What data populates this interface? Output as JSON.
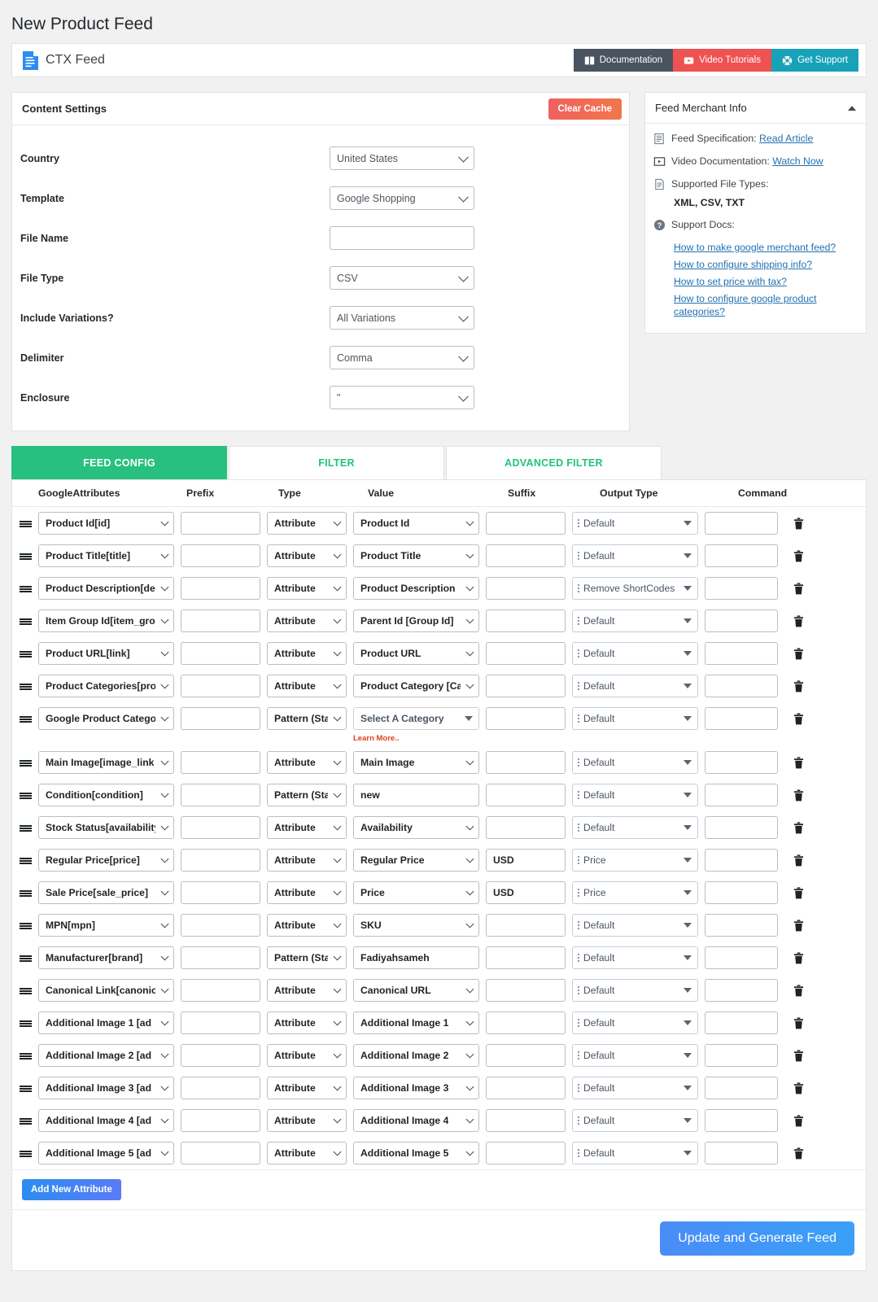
{
  "page": {
    "title": "New Product Feed"
  },
  "app_bar": {
    "brand": "CTX Feed",
    "brand_icon": "document-icon",
    "buttons": [
      {
        "label": "Documentation",
        "icon": "book-icon",
        "color": "#4a5360"
      },
      {
        "label": "Video Tutorials",
        "icon": "video-icon",
        "color": "#ee5253"
      },
      {
        "label": "Get Support",
        "icon": "lifebuoy-icon",
        "color": "#17a2b8"
      }
    ]
  },
  "content_settings": {
    "title": "Content Settings",
    "clear_cache_label": "Clear Cache",
    "fields": [
      {
        "label": "Country",
        "required": true,
        "type": "select",
        "value": "United States"
      },
      {
        "label": "Template",
        "required": true,
        "type": "select",
        "value": "Google Shopping"
      },
      {
        "label": "File Name",
        "required": true,
        "type": "text",
        "value": ""
      },
      {
        "label": "File Type",
        "required": true,
        "type": "select",
        "value": "CSV"
      },
      {
        "label": "Include Variations?",
        "required": true,
        "type": "select",
        "value": "All Variations"
      },
      {
        "label": "Delimiter",
        "required": true,
        "type": "select",
        "value": "Comma"
      },
      {
        "label": "Enclosure",
        "required": true,
        "type": "select",
        "value": "\""
      }
    ]
  },
  "merchant_info": {
    "title": "Feed Merchant Info",
    "spec_label": "Feed Specification:",
    "spec_link": "Read Article",
    "video_label": "Video Documentation:",
    "video_link": "Watch Now",
    "filetypes_label": "Supported File Types:",
    "filetypes_value": "XML, CSV, TXT",
    "support_label": "Support Docs:",
    "support_links": [
      "How to make google merchant feed?",
      "How to configure shipping info?",
      "How to set price with tax?",
      "How to configure google product categories?"
    ]
  },
  "feed": {
    "tabs": [
      {
        "label": "FEED CONFIG",
        "active": true
      },
      {
        "label": "FILTER",
        "active": false
      },
      {
        "label": "ADVANCED FILTER",
        "active": false
      }
    ],
    "columns": [
      "GoogleAttributes",
      "Prefix",
      "Type",
      "Value",
      "Suffix",
      "Output Type",
      "Command"
    ],
    "learn_more_label": "Learn More..",
    "add_attribute_label": "Add New Attribute",
    "generate_label": "Update and Generate Feed",
    "rows": [
      {
        "attribute": "Product Id[id]",
        "prefix": "",
        "type": "Attribute",
        "value": "Product Id",
        "value_kind": "select",
        "suffix": "",
        "output": "Default",
        "command": ""
      },
      {
        "attribute": "Product Title[title]",
        "prefix": "",
        "type": "Attribute",
        "value": "Product Title",
        "value_kind": "select",
        "suffix": "",
        "output": "Default",
        "command": ""
      },
      {
        "attribute": "Product Description[de",
        "prefix": "",
        "type": "Attribute",
        "value": "Product Description",
        "value_kind": "select",
        "suffix": "",
        "output": "Remove ShortCodes",
        "command": ""
      },
      {
        "attribute": "Item Group Id[item_gro",
        "prefix": "",
        "type": "Attribute",
        "value": "Parent Id [Group Id]",
        "value_kind": "select",
        "suffix": "",
        "output": "Default",
        "command": ""
      },
      {
        "attribute": "Product URL[link]",
        "prefix": "",
        "type": "Attribute",
        "value": "Product URL",
        "value_kind": "select",
        "suffix": "",
        "output": "Default",
        "command": ""
      },
      {
        "attribute": "Product Categories[pro",
        "prefix": "",
        "type": "Attribute",
        "value": "Product Category [Ca",
        "value_kind": "select",
        "suffix": "",
        "output": "Default",
        "command": ""
      },
      {
        "attribute": "Google Product Catego",
        "prefix": "",
        "type": "Pattern (Sta",
        "value": "Select A Category",
        "value_kind": "category",
        "suffix": "",
        "output": "Default",
        "command": "",
        "learn_more": true
      },
      {
        "attribute": "Main Image[image_link",
        "prefix": "",
        "type": "Attribute",
        "value": "Main Image",
        "value_kind": "select",
        "suffix": "",
        "output": "Default",
        "command": ""
      },
      {
        "attribute": "Condition[condition]",
        "prefix": "",
        "type": "Pattern (Sta",
        "value": "new",
        "value_kind": "text",
        "suffix": "",
        "output": "Default",
        "command": ""
      },
      {
        "attribute": "Stock Status[availability",
        "prefix": "",
        "type": "Attribute",
        "value": "Availability",
        "value_kind": "select",
        "suffix": "",
        "output": "Default",
        "command": ""
      },
      {
        "attribute": "Regular Price[price]",
        "prefix": "",
        "type": "Attribute",
        "value": "Regular Price",
        "value_kind": "select",
        "suffix": "USD",
        "output": "Price",
        "command": ""
      },
      {
        "attribute": "Sale Price[sale_price]",
        "prefix": "",
        "type": "Attribute",
        "value": "Price",
        "value_kind": "select",
        "suffix": "USD",
        "output": "Price",
        "command": ""
      },
      {
        "attribute": "MPN[mpn]",
        "prefix": "",
        "type": "Attribute",
        "value": "SKU",
        "value_kind": "select",
        "suffix": "",
        "output": "Default",
        "command": ""
      },
      {
        "attribute": "Manufacturer[brand]",
        "prefix": "",
        "type": "Pattern (Sta",
        "value": "Fadiyahsameh",
        "value_kind": "text",
        "suffix": "",
        "output": "Default",
        "command": ""
      },
      {
        "attribute": "Canonical Link[canonic",
        "prefix": "",
        "type": "Attribute",
        "value": "Canonical URL",
        "value_kind": "select",
        "suffix": "",
        "output": "Default",
        "command": ""
      },
      {
        "attribute": "Additional Image 1 [ad",
        "prefix": "",
        "type": "Attribute",
        "value": "Additional Image 1",
        "value_kind": "select",
        "suffix": "",
        "output": "Default",
        "command": ""
      },
      {
        "attribute": "Additional Image 2 [ad",
        "prefix": "",
        "type": "Attribute",
        "value": "Additional Image 2",
        "value_kind": "select",
        "suffix": "",
        "output": "Default",
        "command": ""
      },
      {
        "attribute": "Additional Image 3 [ad",
        "prefix": "",
        "type": "Attribute",
        "value": "Additional Image 3",
        "value_kind": "select",
        "suffix": "",
        "output": "Default",
        "command": ""
      },
      {
        "attribute": "Additional Image 4 [ad",
        "prefix": "",
        "type": "Attribute",
        "value": "Additional Image 4",
        "value_kind": "select",
        "suffix": "",
        "output": "Default",
        "command": ""
      },
      {
        "attribute": "Additional Image 5 [ad",
        "prefix": "",
        "type": "Attribute",
        "value": "Additional Image 5",
        "value_kind": "select",
        "suffix": "",
        "output": "Default",
        "command": ""
      }
    ]
  }
}
